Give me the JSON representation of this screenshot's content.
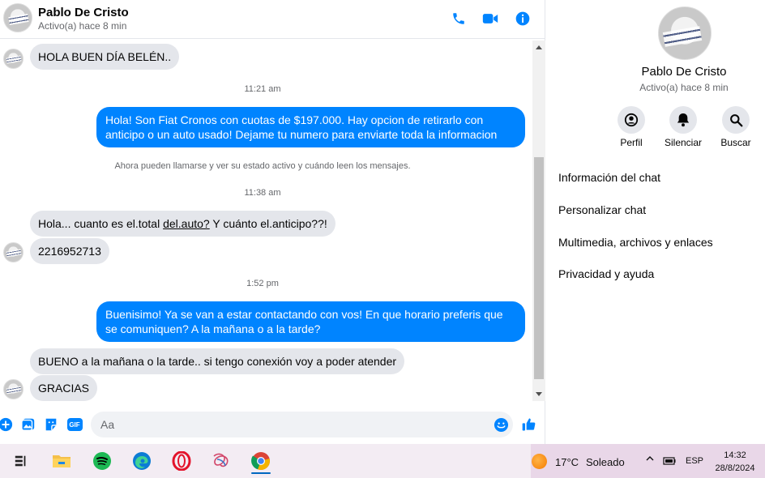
{
  "header": {
    "contact_name": "Pablo De Cristo",
    "status": "Activo(a) hace 8 min",
    "icons": [
      "phone-icon",
      "video-icon",
      "info-icon"
    ]
  },
  "messages": {
    "m1": "HOLA BUEN DÍA BELÉN..",
    "t1": "11:21 am",
    "m2": "Hola! Son Fiat Cronos con cuotas de $197.000. Hay opcion de retirarlo con anticipo o un auto usado! Dejame tu numero para enviarte toda la informacion",
    "system": "Ahora pueden llamarse y ver su estado activo y cuándo leen los mensajes.",
    "t2": "11:38 am",
    "m3_a": "Hola... cuanto es el.total ",
    "m3_link": "del.auto?",
    "m3_b": " Y cuánto el.anticipo??!",
    "m4": "2216952713",
    "t3": "1:52 pm",
    "m5": "Buenisimo! Ya se van a estar contactando con vos! En que horario preferis que se comuniquen? A la mañana o a la tarde?",
    "m6": "BUENO a la mañana o la tarde.. si tengo conexión voy a poder atender",
    "m7": "GRACIAS"
  },
  "composer": {
    "placeholder": "Aa",
    "icons": [
      "plus-icon",
      "photo-icon",
      "sticker-icon",
      "gif-icon",
      "emoji-icon",
      "like-icon"
    ],
    "gif_label": "GIF"
  },
  "info_panel": {
    "name": "Pablo De Cristo",
    "status": "Activo(a) hace 8 min",
    "actions": [
      {
        "label": "Perfil",
        "icon": "profile-icon"
      },
      {
        "label": "Silenciar",
        "icon": "bell-icon"
      },
      {
        "label": "Buscar",
        "icon": "search-icon"
      }
    ],
    "items": [
      "Información del chat",
      "Personalizar chat",
      "Multimedia, archivos y enlaces",
      "Privacidad y ayuda"
    ]
  },
  "taskbar": {
    "apps": [
      "task-view-icon",
      "file-explorer-icon",
      "spotify-icon",
      "edge-icon",
      "opera-icon",
      "app-icon",
      "chrome-icon"
    ],
    "temperature": "17°C",
    "condition": "Soleado",
    "language": "ESP",
    "time": "14:32",
    "date": "28/8/2024"
  },
  "colors": {
    "accent": "#0084ff",
    "incoming_bubble": "#e4e6eb"
  }
}
